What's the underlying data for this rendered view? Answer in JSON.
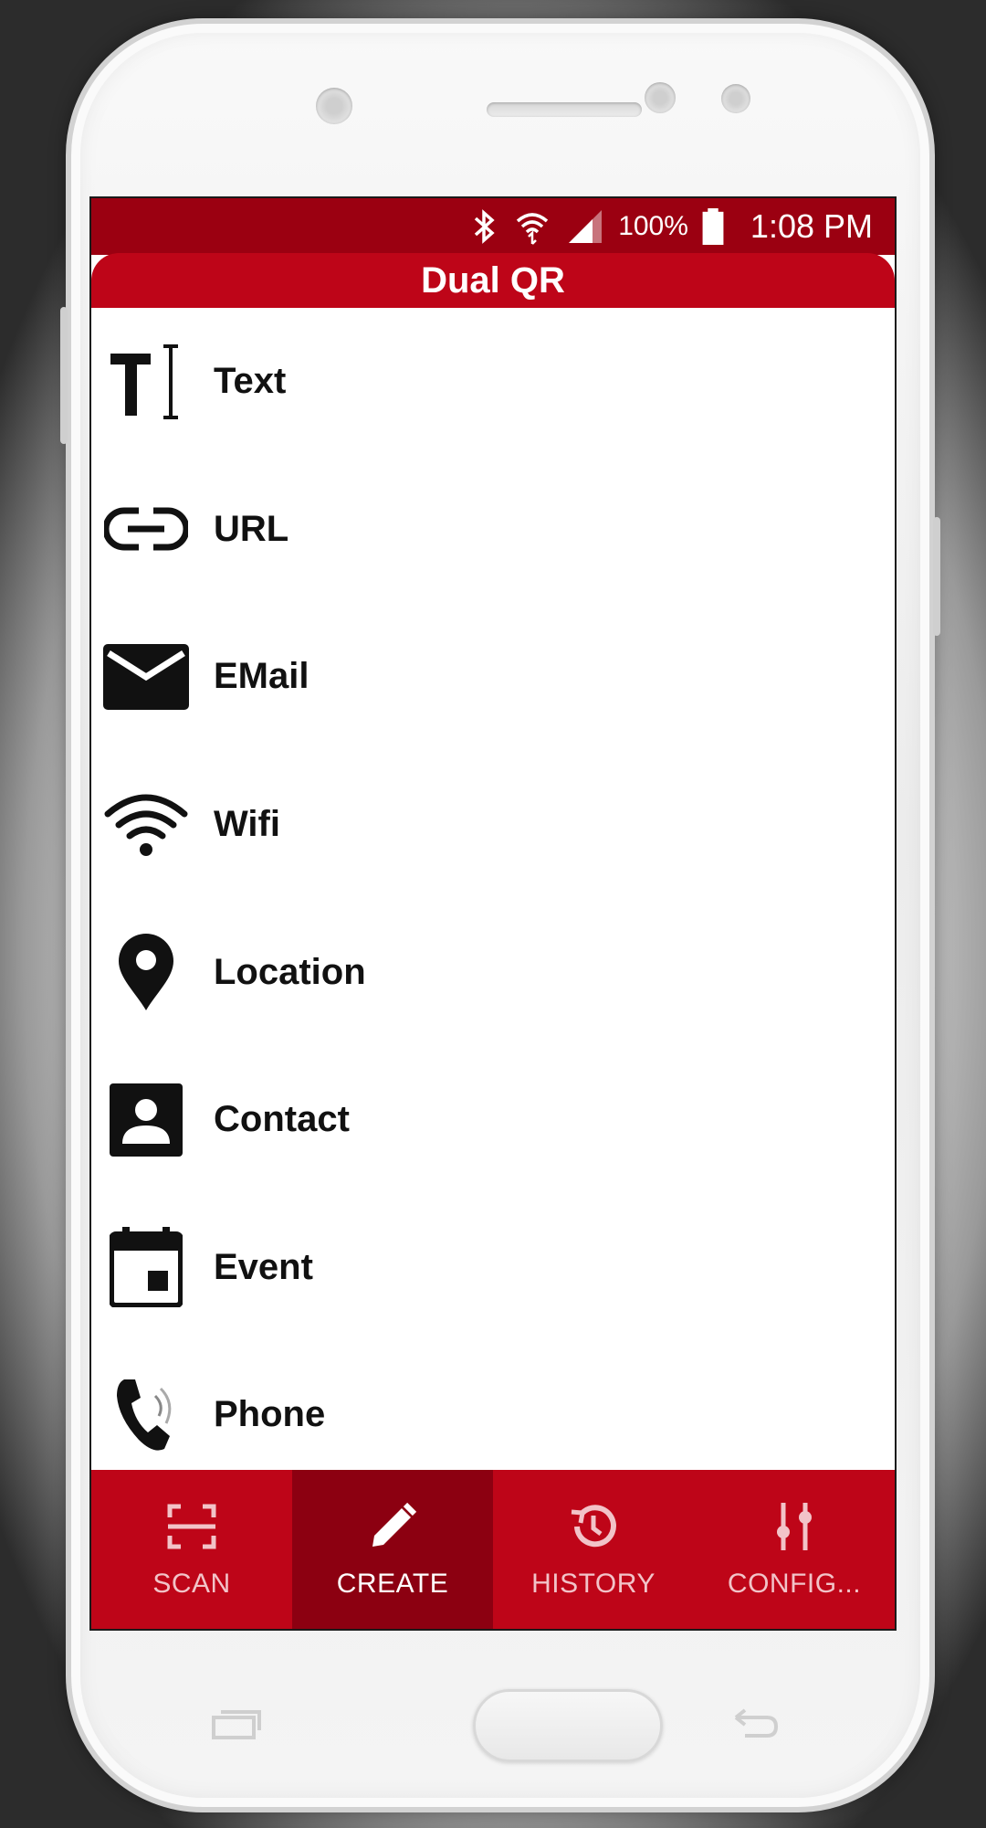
{
  "status_bar": {
    "battery": "100%",
    "time": "1:08 PM"
  },
  "app_bar": {
    "title": "Dual QR"
  },
  "create_list": [
    {
      "label": "Text",
      "icon": "text-format-icon"
    },
    {
      "label": "URL",
      "icon": "link-icon"
    },
    {
      "label": "EMail",
      "icon": "email-icon"
    },
    {
      "label": "Wifi",
      "icon": "wifi-icon"
    },
    {
      "label": "Location",
      "icon": "location-pin-icon"
    },
    {
      "label": "Contact",
      "icon": "contact-card-icon"
    },
    {
      "label": "Event",
      "icon": "calendar-event-icon"
    },
    {
      "label": "Phone",
      "icon": "phone-icon"
    }
  ],
  "bottom_nav": {
    "tabs": [
      {
        "label": "SCAN",
        "icon": "scan-icon",
        "active": false
      },
      {
        "label": "CREATE",
        "icon": "pencil-icon",
        "active": true
      },
      {
        "label": "HISTORY",
        "icon": "history-icon",
        "active": false
      },
      {
        "label": "CONFIG...",
        "icon": "sliders-icon",
        "active": false
      }
    ]
  },
  "colors": {
    "status_bar": "#9b0011",
    "primary": "#be0518",
    "active_tab": "#8c0011"
  }
}
